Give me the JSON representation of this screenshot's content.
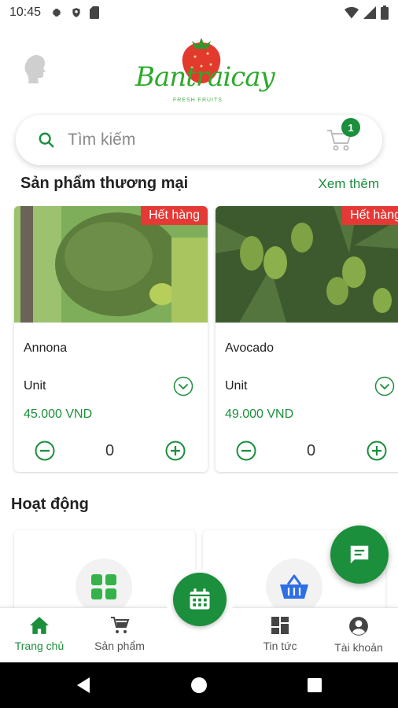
{
  "status_bar": {
    "time": "10:45"
  },
  "header": {
    "logo_text": "Bantraicay",
    "logo_sub": "FRESH FRUITS"
  },
  "search": {
    "placeholder": "Tìm kiếm",
    "cart_count": "1"
  },
  "section": {
    "title": "Sản phẩm thương mại",
    "see_more": "Xem thêm"
  },
  "products": [
    {
      "name": "Annona",
      "badge": "Hết hàng",
      "unit": "Unit",
      "price": "45.000 VND",
      "qty": "0"
    },
    {
      "name": "Avocado",
      "badge": "Hết hàng",
      "unit": "Unit",
      "price": "49.000 VND",
      "qty": "0"
    }
  ],
  "activities": {
    "title": "Hoạt động"
  },
  "bottom_nav": {
    "items": [
      {
        "label": "Trang chủ",
        "icon": "home-icon"
      },
      {
        "label": "Sản phẩm",
        "icon": "cart-icon"
      },
      {
        "label": "Tin tức",
        "icon": "dashboard-icon"
      },
      {
        "label": "Tài khoản",
        "icon": "account-icon"
      }
    ]
  },
  "colors": {
    "primary": "#1b8f3c",
    "badge": "#e53935",
    "logo": "#2daa2b"
  }
}
